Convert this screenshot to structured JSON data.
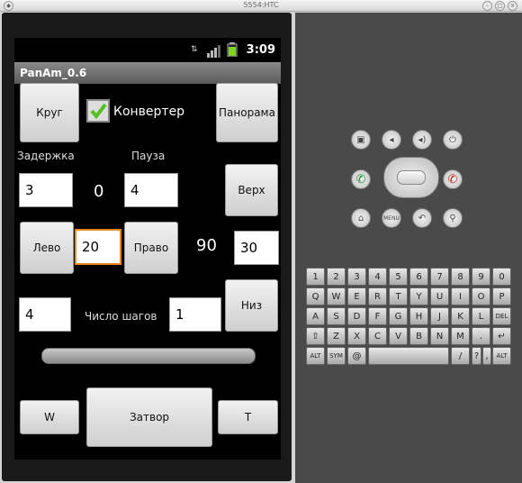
{
  "window": {
    "title": "5554:HTC"
  },
  "status": {
    "time": "3:09"
  },
  "app": {
    "title": "PanAm_0.6",
    "buttons": {
      "krug": "Круг",
      "panorama": "Панорама",
      "verkh": "Верх",
      "levo": "Лево",
      "pravo": "Право",
      "niz": "Низ",
      "w": "W",
      "zatvor": "Затвор",
      "t": "T"
    },
    "checkbox": {
      "label": "Конвертер",
      "checked": true
    },
    "labels": {
      "delay": "Задержка",
      "pause": "Пауза",
      "steps": "Число шагов"
    },
    "fields": {
      "delay": "3",
      "pause": "4",
      "step_angle": "20",
      "offset": "30",
      "left_count": "4",
      "step_count": "1"
    },
    "values": {
      "zero": "0",
      "ninety": "90"
    }
  },
  "keyboard": {
    "rows": [
      [
        "Q",
        "W",
        "E",
        "R",
        "T",
        "Y",
        "U",
        "I",
        "O",
        "P"
      ],
      [
        "A",
        "S",
        "D",
        "F",
        "G",
        "H",
        "J",
        "K",
        "L",
        "DEL"
      ],
      [
        "⇧",
        "Z",
        "X",
        "C",
        "V",
        "B",
        "N",
        "M",
        ".",
        "↵"
      ],
      [
        "ALT",
        "SYM",
        "@",
        " ",
        "/",
        "?",
        ",",
        "ALT"
      ]
    ],
    "top": [
      "1",
      "2",
      "3",
      "4",
      "5",
      "6",
      "7",
      "8",
      "9",
      "0"
    ]
  }
}
